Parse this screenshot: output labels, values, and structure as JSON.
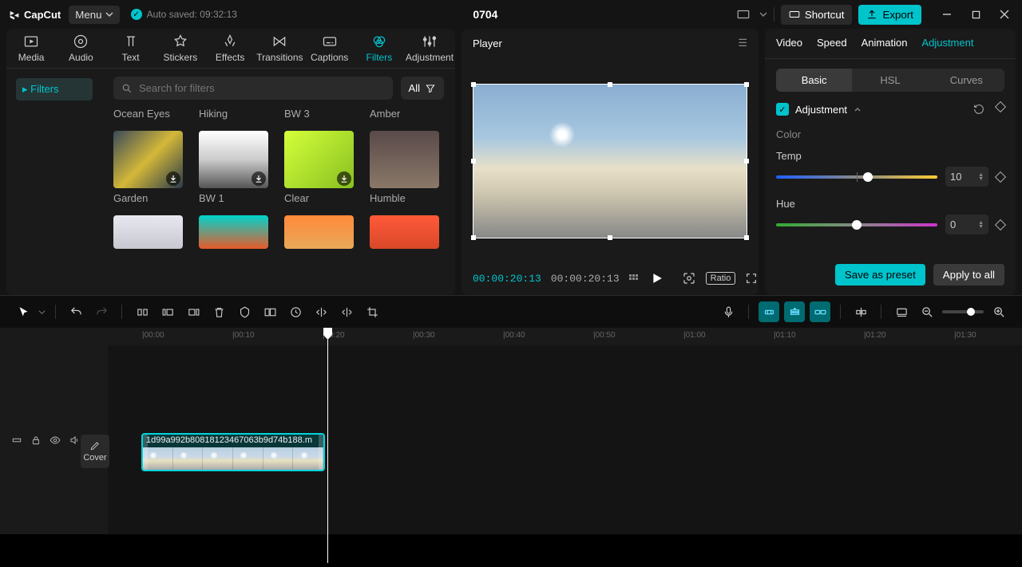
{
  "titlebar": {
    "brand": "CapCut",
    "menu": "Menu",
    "autosave": "Auto saved: 09:32:13",
    "title": "0704",
    "shortcut": "Shortcut",
    "export": "Export"
  },
  "tabs": [
    "Media",
    "Audio",
    "Text",
    "Stickers",
    "Effects",
    "Transitions",
    "Captions",
    "Filters",
    "Adjustment"
  ],
  "active_tab": "Filters",
  "filters": {
    "category": "Filters",
    "search_placeholder": "Search for filters",
    "all": "All",
    "top_row_labels": [
      "Ocean Eyes",
      "Hiking",
      "BW 3",
      "Amber"
    ],
    "items": [
      {
        "name": "Garden",
        "bg": "linear-gradient(135deg,#3a4a5a,#d4b838,#2a3a4a)"
      },
      {
        "name": "BW 1",
        "bg": "linear-gradient(#ffffff,#cccccc,#888888)"
      },
      {
        "name": "Clear",
        "bg": "linear-gradient(135deg,#d4ff3a,#a8e020)"
      },
      {
        "name": "Humble",
        "bg": "linear-gradient(#5a4a4a,#8a7868)"
      }
    ],
    "bottom_row": [
      {
        "bg": "linear-gradient(#e8e8f0,#c8c8d0)"
      },
      {
        "bg": "linear-gradient(#00d4cc,#e85a2a)"
      },
      {
        "bg": "linear-gradient(#ff8a3a,#e8a858)"
      },
      {
        "bg": "linear-gradient(#ff5a3a,#d84828)"
      }
    ]
  },
  "player": {
    "title": "Player",
    "time_current": "00:00:20:13",
    "time_total": "00:00:20:13",
    "ratio_label": "Ratio"
  },
  "inspector": {
    "tabs": [
      "Video",
      "Speed",
      "Animation",
      "Adjustment"
    ],
    "active": "Adjustment",
    "subtabs": [
      "Basic",
      "HSL",
      "Curves"
    ],
    "active_sub": "Basic",
    "section": "Adjustment",
    "color_label": "Color",
    "temp": {
      "label": "Temp",
      "value": 10
    },
    "hue": {
      "label": "Hue",
      "value": 0
    },
    "save_preset": "Save as preset",
    "apply_all": "Apply to all"
  },
  "timeline": {
    "ticks": [
      "|00:00",
      "|00:10",
      "|00:20",
      "|00:30",
      "|00:40",
      "|00:50",
      "|01:00",
      "|01:10",
      "|01:20",
      "|01:30"
    ],
    "cover": "Cover",
    "clip_name": "1d99a992b80818123467063b9d74b188.m"
  }
}
